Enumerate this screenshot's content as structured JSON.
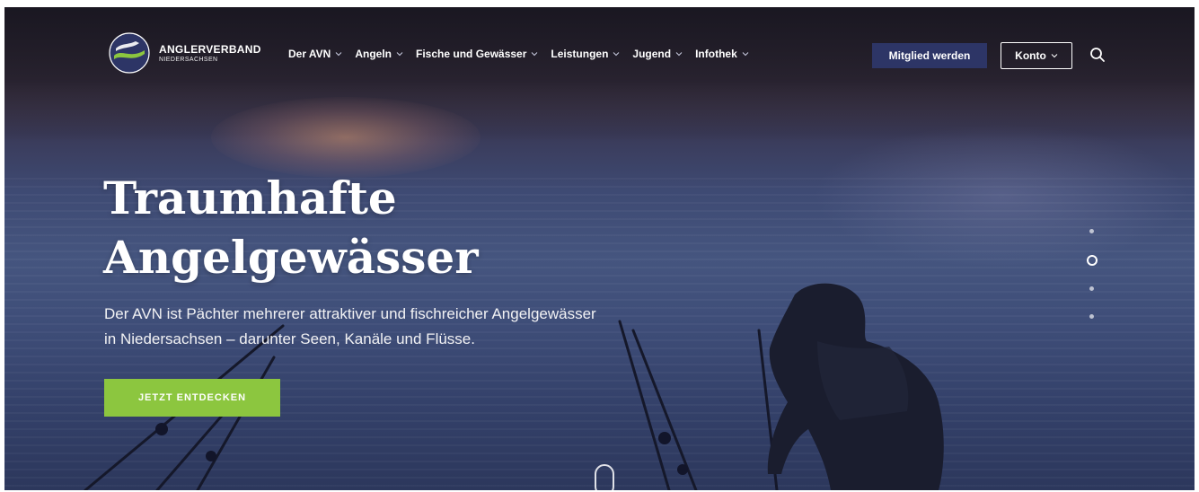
{
  "header": {
    "logo": {
      "line1": "ANGLERVERBAND",
      "line2": "NIEDERSACHSEN",
      "icon": "avn-logo-icon",
      "colors": {
        "navy": "#2d3566",
        "green": "#8cc63f"
      }
    },
    "nav": [
      {
        "label": "Der AVN"
      },
      {
        "label": "Angeln"
      },
      {
        "label": "Fische und Gewässer"
      },
      {
        "label": "Leistungen"
      },
      {
        "label": "Jugend"
      },
      {
        "label": "Infothek"
      }
    ],
    "member_button": "Mitglied werden",
    "account_button": "Konto",
    "search_icon": "search-icon"
  },
  "hero": {
    "title_line1": "Traumhafte",
    "title_line2": "Angelgewässer",
    "subtitle_line1": "Der AVN ist Pächter mehrerer attraktiver und fischreicher Angelgewässer",
    "subtitle_line2": "in Niedersachsen – darunter Seen, Kanäle und Flüsse.",
    "cta": "JETZT ENTDECKEN",
    "slider": {
      "total": 4,
      "active": 2
    },
    "scroll_icon": "mouse-scroll-icon"
  },
  "colors": {
    "accent_green": "#8cc63f",
    "navy_button": "#2d3566",
    "text": "#ffffff"
  }
}
